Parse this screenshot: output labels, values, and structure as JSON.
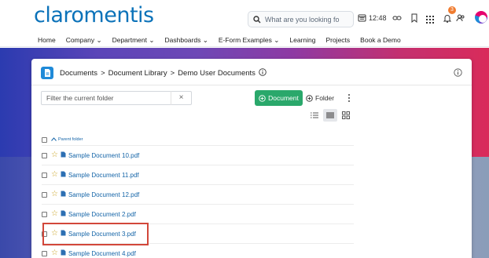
{
  "header": {
    "logo": "claromentis",
    "search_placeholder": "What are you looking fo",
    "clock": "12:48",
    "notification_count": "3",
    "colors": {
      "logo": "#0b72b9",
      "badge": "#f07c30"
    }
  },
  "nav": {
    "items": [
      {
        "label": "Home",
        "dropdown": false
      },
      {
        "label": "Company",
        "dropdown": true
      },
      {
        "label": "Department",
        "dropdown": true
      },
      {
        "label": "Dashboards",
        "dropdown": true
      },
      {
        "label": "E-Form Examples",
        "dropdown": true
      },
      {
        "label": "Learning",
        "dropdown": false
      },
      {
        "label": "Projects",
        "dropdown": false
      },
      {
        "label": "Book a Demo",
        "dropdown": false
      }
    ]
  },
  "breadcrumb": {
    "items": [
      "Documents",
      "Document Library",
      "Demo User Documents"
    ],
    "separator": ">"
  },
  "toolbar": {
    "filter_placeholder": "Filter the current folder",
    "clear_label": "×",
    "document_button": "Document",
    "folder_button": "Folder",
    "document_button_color": "#2aa86b"
  },
  "list": {
    "parent_label": "Parent folder",
    "files": [
      "Sample Document 10.pdf",
      "Sample Document 11.pdf",
      "Sample Document 12.pdf",
      "Sample Document 2.pdf",
      "Sample Document 3.pdf",
      "Sample Document 4.pdf"
    ],
    "highlighted_file": "Sample Document 3.pdf",
    "highlight_color": "#d2473a"
  }
}
